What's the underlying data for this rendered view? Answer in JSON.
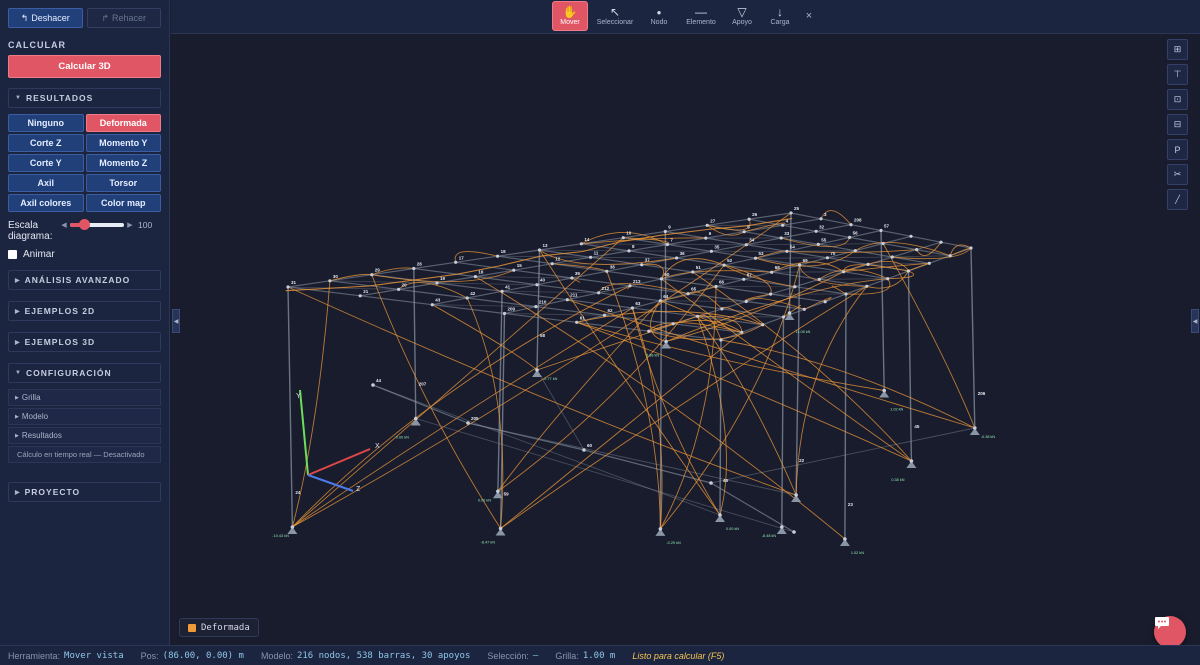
{
  "sidebar": {
    "undo_label": "Deshacer",
    "redo_label": "Rehacer",
    "calc_section": "CALCULAR",
    "calc_button": "Calcular 3D",
    "results_section": "RESULTADOS",
    "result_buttons": [
      "Ninguno",
      "Deformada",
      "Corte Z",
      "Momento Y",
      "Corte Y",
      "Momento Z",
      "Axil",
      "Torsor",
      "Axil colores",
      "Color map"
    ],
    "active_result": "Deformada",
    "scale_label": "Escala diagrama:",
    "scale_value": "100",
    "scale_fraction": 0.2,
    "animate_label": "Animar",
    "advanced_section": "ANÁLISIS AVANZADO",
    "examples2d_section": "EJEMPLOS 2D",
    "examples3d_section": "EJEMPLOS 3D",
    "config_section": "CONFIGURACIÓN",
    "config_items": [
      "Grilla",
      "Modelo",
      "Resultados"
    ],
    "realtime_label": "Cálculo en tiempo real — Desactivado",
    "project_section": "PROYECTO"
  },
  "toolbar": {
    "tools": [
      {
        "label": "Mover",
        "icon": "hand-icon",
        "glyph": "✋"
      },
      {
        "label": "Seleccionar",
        "icon": "cursor-icon",
        "glyph": "↖"
      },
      {
        "label": "Nodo",
        "icon": "node-icon",
        "glyph": "●"
      },
      {
        "label": "Elemento",
        "icon": "element-icon",
        "glyph": "—"
      },
      {
        "label": "Apoyo",
        "icon": "support-icon",
        "glyph": "▽"
      },
      {
        "label": "Carga",
        "icon": "load-icon",
        "glyph": "↓"
      }
    ],
    "active_tool": "Mover",
    "close_glyph": "×"
  },
  "viewport": {
    "axes": {
      "y": "Y",
      "x": "X",
      "z": "Z"
    },
    "legend_label": "Deformada",
    "side_tools": [
      {
        "icon": "grid-view-icon",
        "glyph": "⊞"
      },
      {
        "icon": "top-view-icon",
        "glyph": "⊤"
      },
      {
        "icon": "front-view-icon",
        "glyph": "⊡"
      },
      {
        "icon": "side-view-icon",
        "glyph": "⊟"
      },
      {
        "icon": "perspective-icon",
        "glyph": "P"
      },
      {
        "icon": "cut-icon",
        "glyph": "✂"
      },
      {
        "icon": "measure-icon",
        "glyph": "📏"
      }
    ],
    "node_labels": [
      "31",
      "30",
      "29",
      "28",
      "17",
      "18",
      "13",
      "14",
      "10",
      "9",
      "27",
      "26",
      "25",
      "24",
      "23",
      "22",
      "21",
      "20",
      "19",
      "16",
      "15",
      "12",
      "11",
      "8",
      "7",
      "6",
      "5",
      "4",
      "3",
      "46",
      "45",
      "44",
      "43",
      "42",
      "41",
      "40",
      "39",
      "38",
      "37",
      "36",
      "35",
      "34",
      "33",
      "32",
      "208",
      "207",
      "206",
      "205",
      "209",
      "210",
      "211",
      "212",
      "213",
      "50",
      "51",
      "52",
      "53",
      "54",
      "55",
      "56",
      "57",
      "58",
      "59",
      "60",
      "61",
      "62",
      "63",
      "64",
      "65",
      "66",
      "67",
      "68",
      "69",
      "70"
    ],
    "reaction_labels": [
      "-10.43 kN",
      "0.00 kN",
      "0.00 kN",
      "-2.77 kN",
      "2.88 kN",
      "11.08 kN",
      "-8.48 kN",
      "1.02 kN",
      "0.38 kN",
      "-0.38 kN",
      "-8.47 kN",
      "1.02 kN",
      "0.00 kN",
      "-0.29 kN"
    ]
  },
  "colors": {
    "accent": "#e15664",
    "deformed": "#f09a3a",
    "structure": "#8c98a6"
  },
  "status": {
    "tool_label": "Herramienta:",
    "tool_value": "Mover vista",
    "pos_label": "Pos:",
    "pos_value": "(86.00, 0.00) m",
    "model_label": "Modelo:",
    "model_value": "216 nodos, 538 barras, 30 apoyos",
    "selection_label": "Selección:",
    "selection_value": "—",
    "grid_label": "Grilla:",
    "grid_value": "1.00 m",
    "ready_text": "Listo para calcular (F5)"
  }
}
